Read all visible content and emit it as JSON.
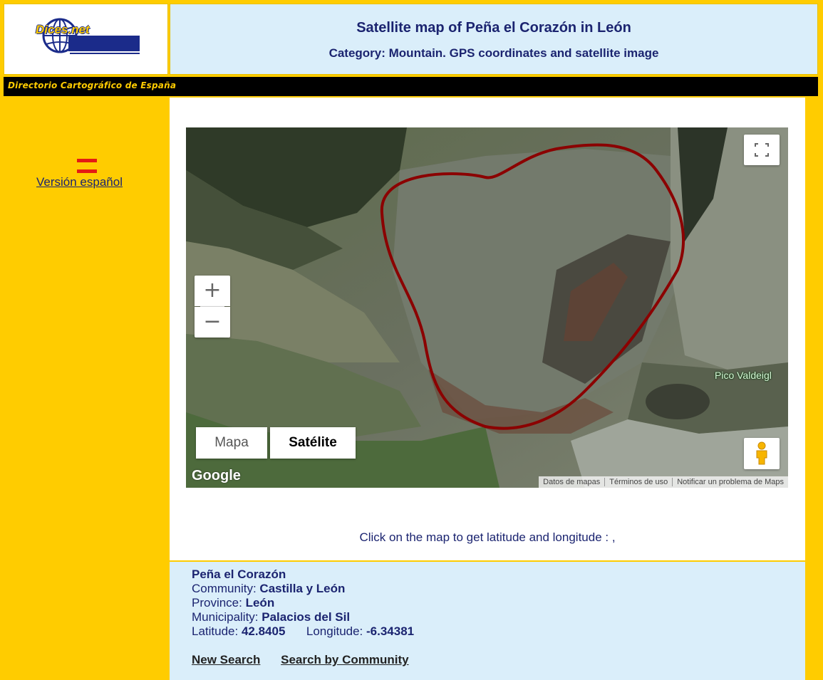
{
  "header": {
    "logo_text": "Dices.net",
    "title": "Satellite map of Peña el Corazón in León",
    "subtitle": "Category: Mountain. GPS coordinates and satellite image"
  },
  "band": {
    "text": "Directorio Cartográfico de España"
  },
  "sidebar": {
    "language_link": "Versión español"
  },
  "map": {
    "fullscreen_icon": "fullscreen-icon",
    "zoom_in": "+",
    "zoom_out": "−",
    "maptype_options": [
      "Mapa",
      "Satélite"
    ],
    "selected_maptype": "Satélite",
    "google_logo": "Google",
    "footer_links": [
      "Datos de mapas",
      "Términos de uso",
      "Notificar un problema de Maps"
    ],
    "place_label": "Pico Valdeigl",
    "pegman_icon": "pegman-icon",
    "outline_color": "#8b0000"
  },
  "click_info": "Click on the map to get latitude and longitude : ,",
  "info": {
    "name": "Peña el Corazón",
    "community_label": "Community: ",
    "community": "Castilla y León",
    "province_label": "Province: ",
    "province": "León",
    "municipality_label": "Municipality: ",
    "municipality": "Palacios del Sil",
    "latitude_label": "Latitude: ",
    "latitude": "42.8405",
    "longitude_label": "Longitude: ",
    "longitude": "-6.34381"
  },
  "links": {
    "new_search": "New Search",
    "search_by_community": "Search by Community"
  }
}
